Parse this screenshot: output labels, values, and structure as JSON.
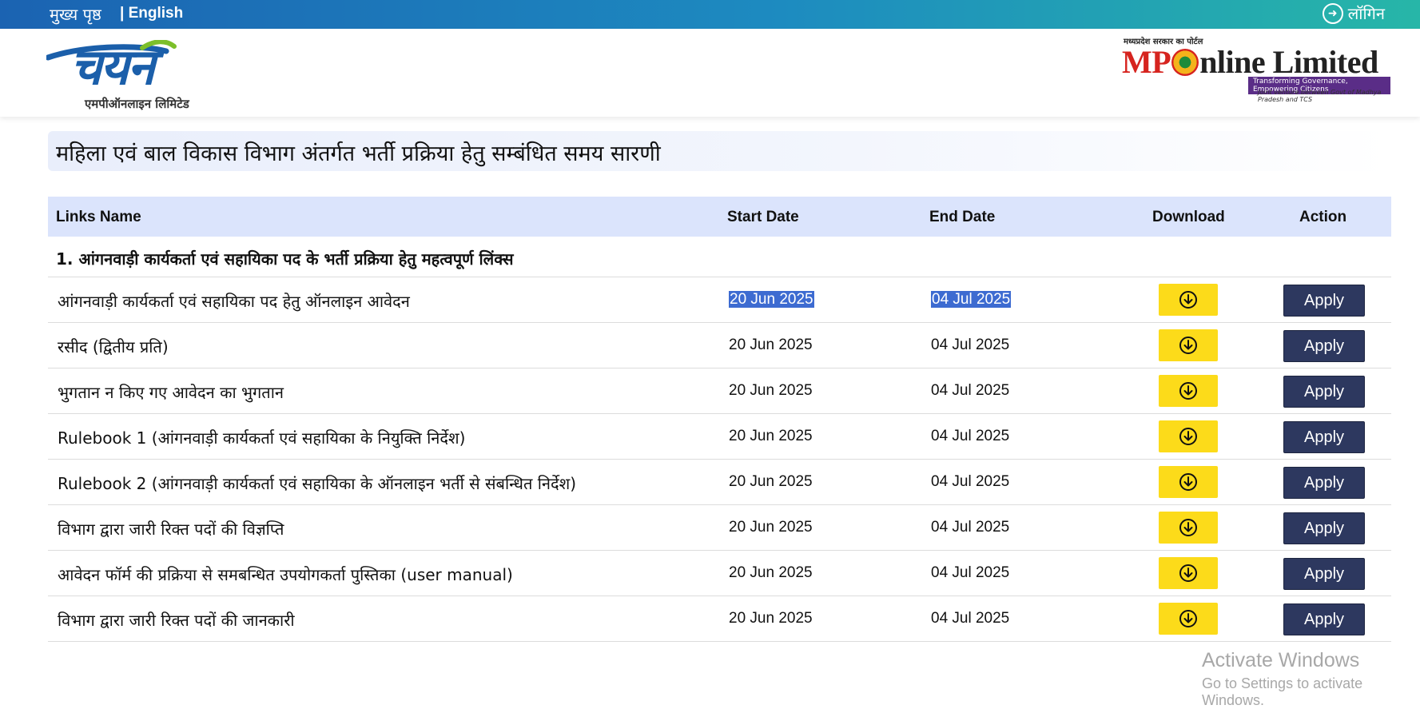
{
  "topbar": {
    "home": "मुख्य पृष्ठ",
    "lang": "| English",
    "login": "लॉगिन",
    "login_icon": "arrow-right-circle-icon"
  },
  "header": {
    "left_logo_word": "चयन",
    "left_logo_sub": "एमपीऑनलाइन लिमिटेड",
    "right_logo_tiny": "मध्यप्रदेश सरकार का पोर्टल",
    "right_logo_mp": "MP",
    "right_logo_rest": "nline Limited",
    "right_logo_tag": "Transforming Governance, Empowering Citizens",
    "right_logo_jv": "Joint venture between Govt of Madhya Pradesh and TCS"
  },
  "page_title": "महिला एवं बाल विकास विभाग अंतर्गत भर्ती प्रक्रिया हेतु सम्बंधित समय सारणी",
  "table": {
    "headers": {
      "name": "Links Name",
      "start": "Start Date",
      "end": "End Date",
      "download": "Download",
      "action": "Action"
    },
    "group": "1. आंगनवाड़ी कार्यकर्ता एवं सहायिका पद के भर्ती प्रक्रिया हेतु महत्वपूर्ण लिंक्स",
    "action_label": "Apply",
    "rows": [
      {
        "name": "आंगनवाड़ी कार्यकर्ता एवं सहायिका पद हेतु ऑनलाइन आवेदन",
        "start": "20 Jun 2025",
        "end": "04 Jul 2025"
      },
      {
        "name": "रसीद (द्वितीय प्रति)",
        "start": "20 Jun 2025",
        "end": "04 Jul 2025"
      },
      {
        "name": "भुगतान न किए गए आवेदन का भुगतान",
        "start": "20 Jun 2025",
        "end": "04 Jul 2025"
      },
      {
        "name": "Rulebook 1 (आंगनवाड़ी कार्यकर्ता एवं सहायिका के नियुक्ति निर्देश)",
        "start": "20 Jun 2025",
        "end": "04 Jul 2025"
      },
      {
        "name": "Rulebook 2 (आंगनवाड़ी कार्यकर्ता एवं सहायिका के ऑनलाइन भर्ती से संबन्धित निर्देश)",
        "start": "20 Jun 2025",
        "end": "04 Jul 2025"
      },
      {
        "name": "विभाग द्वारा जारी रिक्त पदों की विज्ञप्ति",
        "start": "20 Jun 2025",
        "end": "04 Jul 2025"
      },
      {
        "name": "आवेदन फॉर्म की प्रक्रिया से समबन्धित उपयोगकर्ता पुस्तिका (user manual)",
        "start": "20 Jun 2025",
        "end": "04 Jul 2025"
      },
      {
        "name": "विभाग द्वारा जारी रिक्त पदों की जानकारी",
        "start": "20 Jun 2025",
        "end": "04 Jul 2025"
      }
    ]
  },
  "colors": {
    "download_button": "#fcdb1a",
    "apply_button": "#2d385f",
    "header_row": "#dbe4fc",
    "selection": "#3d6bd1"
  },
  "watermark": {
    "line1": "Activate Windows",
    "line2": "Go to Settings to activate Windows."
  }
}
